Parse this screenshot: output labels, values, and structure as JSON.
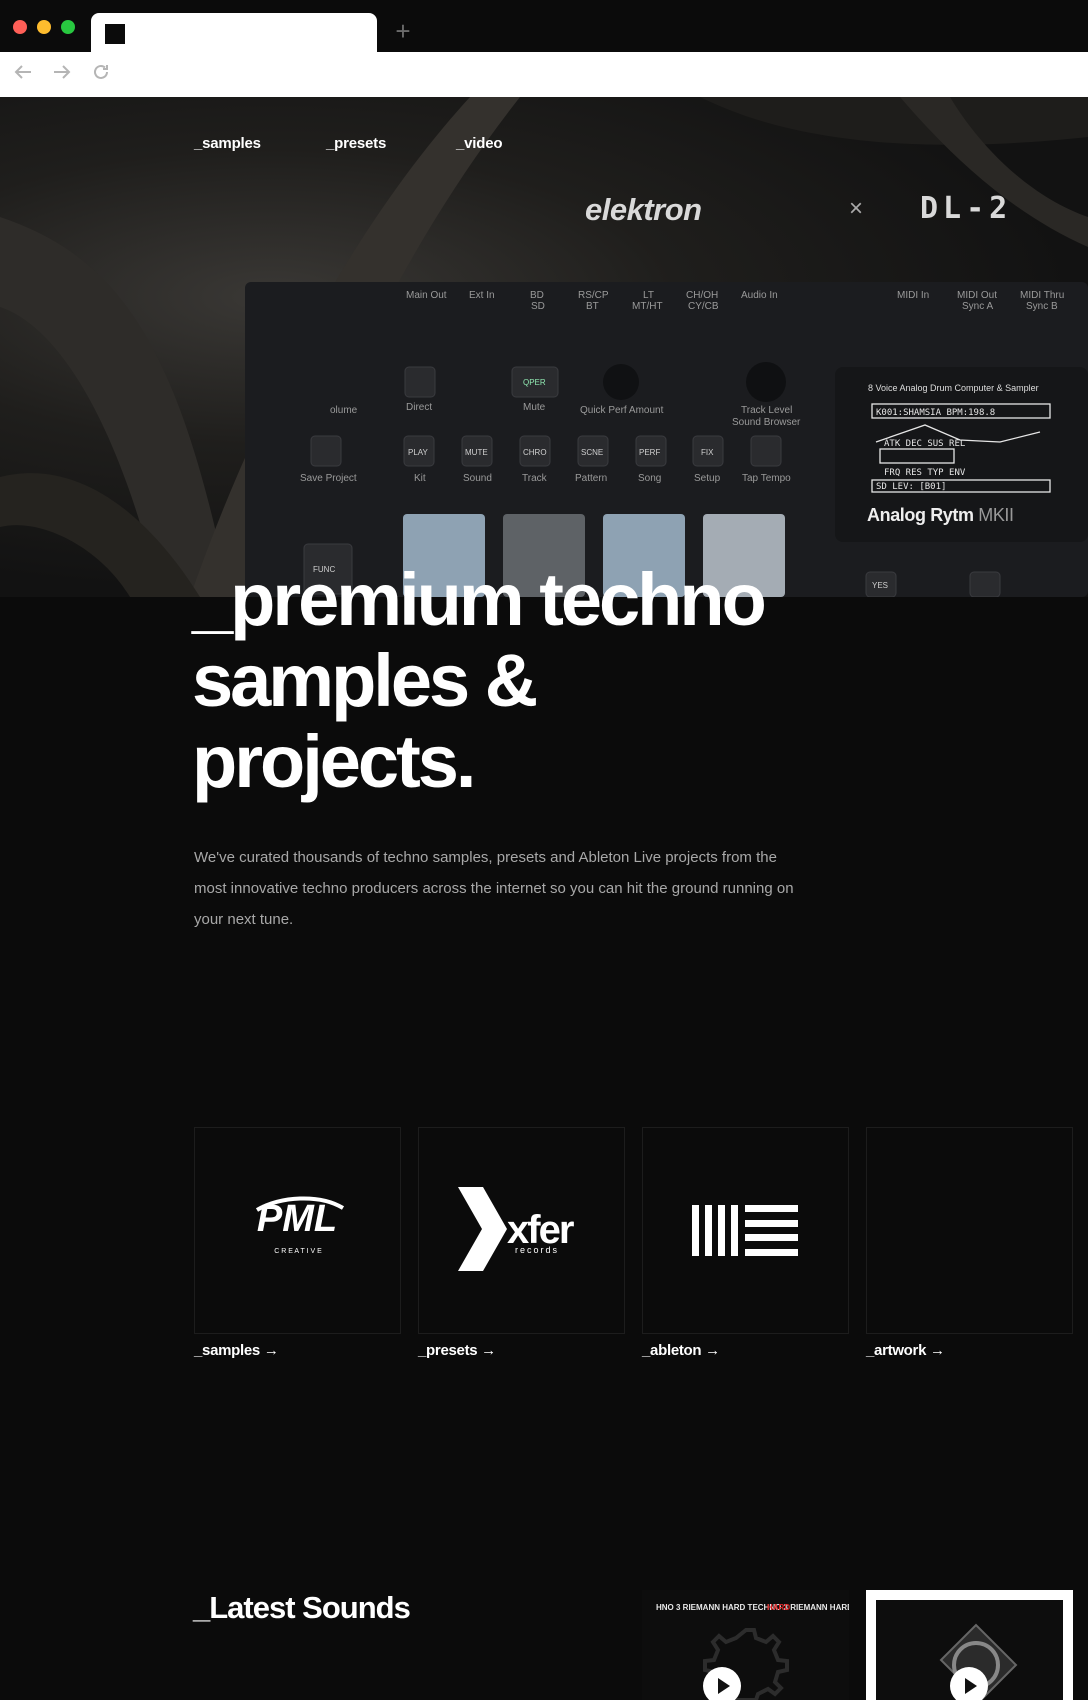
{
  "nav": {
    "samples": "_samples",
    "presets": "_presets",
    "video": "_video"
  },
  "hero": {
    "brand": "elektron",
    "collab_mark": "×",
    "partner": "DL-2",
    "device_caption": "8 Voice Analog Drum Computer & Sampler",
    "device_name": "Analog Rytm",
    "device_suffix": "MKII",
    "lcd_line1": "K001:SHAMSIA   BPM:198.8",
    "lcd_params": "ATK  DEC  SUS  REL",
    "lcd_params2": "FRQ  RES  TYP  ENV",
    "lcd_footer": "SD LEV:   [B01]"
  },
  "headline": {
    "line1": "_premium techno",
    "line2": "samples &",
    "line3": "projects."
  },
  "lead": "We've curated thousands of techno samples, presets and Ableton Live projects from the most innovative techno producers across the internet so you can hit the ground running on your next tune.",
  "categories": [
    {
      "label": "_samples →",
      "logo": "pml-creative-logo",
      "logo_text": "PML",
      "logo_sub": "C R E A T I V E"
    },
    {
      "label": "_presets →",
      "logo": "xfer-records-logo",
      "logo_text": "xfer",
      "logo_sub": "records"
    },
    {
      "label": "_ableton →",
      "logo": "ableton-logo"
    },
    {
      "label": "_artwork →",
      "logo": ""
    }
  ],
  "latest": {
    "title": "_Latest Sounds",
    "release1_text": "HNO 3 RIEMANN HARD TECHNO 3 RIEMANN HARD TECHN",
    "release1_accent": "HARD"
  },
  "colors": {
    "background": "#0b0b0b",
    "text": "#ffffff",
    "muted": "#a8a8a8",
    "card_border": "#1d1d1d"
  }
}
